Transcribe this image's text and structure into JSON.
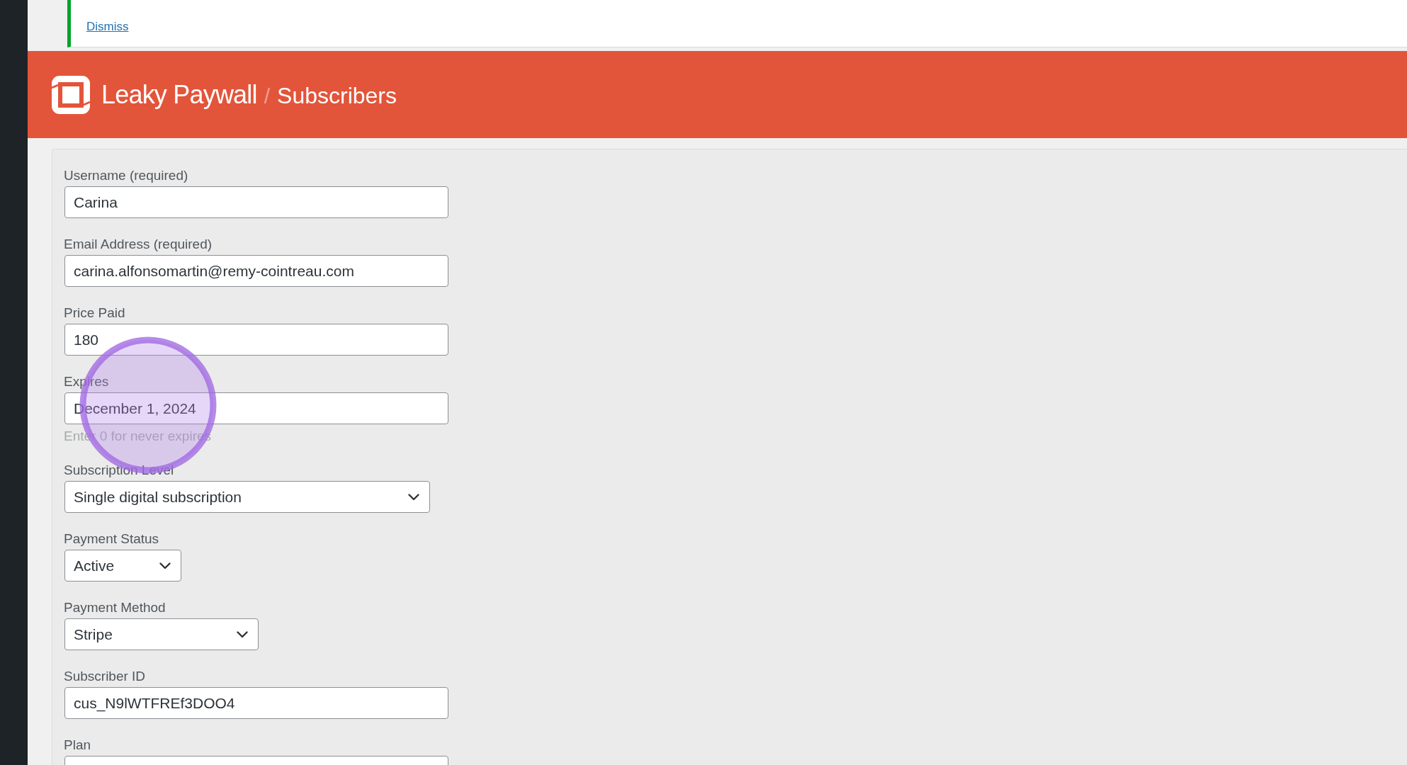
{
  "notice": {
    "dismiss_link": "Dismiss"
  },
  "header": {
    "brand": "Leaky Paywall",
    "separator": "/",
    "page_title": "Subscribers"
  },
  "form": {
    "fields": [
      {
        "kind": "text",
        "label": "Username (required)",
        "value": "Carina"
      },
      {
        "kind": "text",
        "label": "Email Address (required)",
        "value": "carina.alfonsomartin@remy-cointreau.com"
      },
      {
        "kind": "text",
        "label": "Price Paid",
        "value": "180"
      },
      {
        "kind": "text",
        "label": "Expires",
        "value": "December 1, 2024",
        "hint": "Enter 0 for never expires"
      },
      {
        "kind": "select",
        "label": "Subscription Level",
        "value": "Single digital subscription"
      },
      {
        "kind": "select",
        "label": "Payment Status",
        "value": "Active"
      },
      {
        "kind": "select",
        "label": "Payment Method",
        "value": "Stripe"
      },
      {
        "kind": "text",
        "label": "Subscriber ID",
        "value": "cus_N9lWTFREf3DOO4"
      },
      {
        "kind": "text",
        "label": "Plan"
      }
    ]
  }
}
